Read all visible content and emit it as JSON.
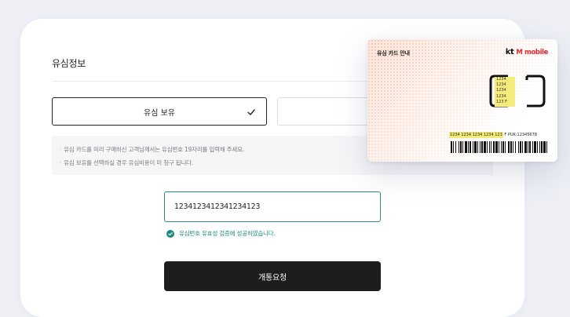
{
  "form": {
    "section_title": "유심정보",
    "options": [
      {
        "label": "유심 보유",
        "selected": true
      },
      {
        "label": "",
        "selected": false
      }
    ],
    "notices": [
      "유심 카드를 미리 구매하신 고객님께서는 유심번호 19자리를 입력해 주세요.",
      "유심 보유를 선택하실 경우 유심비용이 미 청구 됩니다."
    ],
    "sim_number_value": "1234123412341234123",
    "validation_message": "유심번호 유효성 검증에 성공하였습니다.",
    "submit_label": "개통요청"
  },
  "sim_card": {
    "title": "유심 카드 안내",
    "brand_kt": "kt",
    "brand_mobile": "M mobile",
    "chip_numbers": [
      "1234",
      "1234",
      "1234",
      "1234",
      "123"
    ],
    "chip_suffix": "F",
    "serial_highlight": "1234 1234 1234 1234 123",
    "serial_rest": "F  PUK:12345678"
  },
  "colors": {
    "accent": "#1f8a80",
    "primary_button": "#1d1d1f",
    "highlight": "#f4ec7a",
    "brand_red": "#e0282f"
  }
}
